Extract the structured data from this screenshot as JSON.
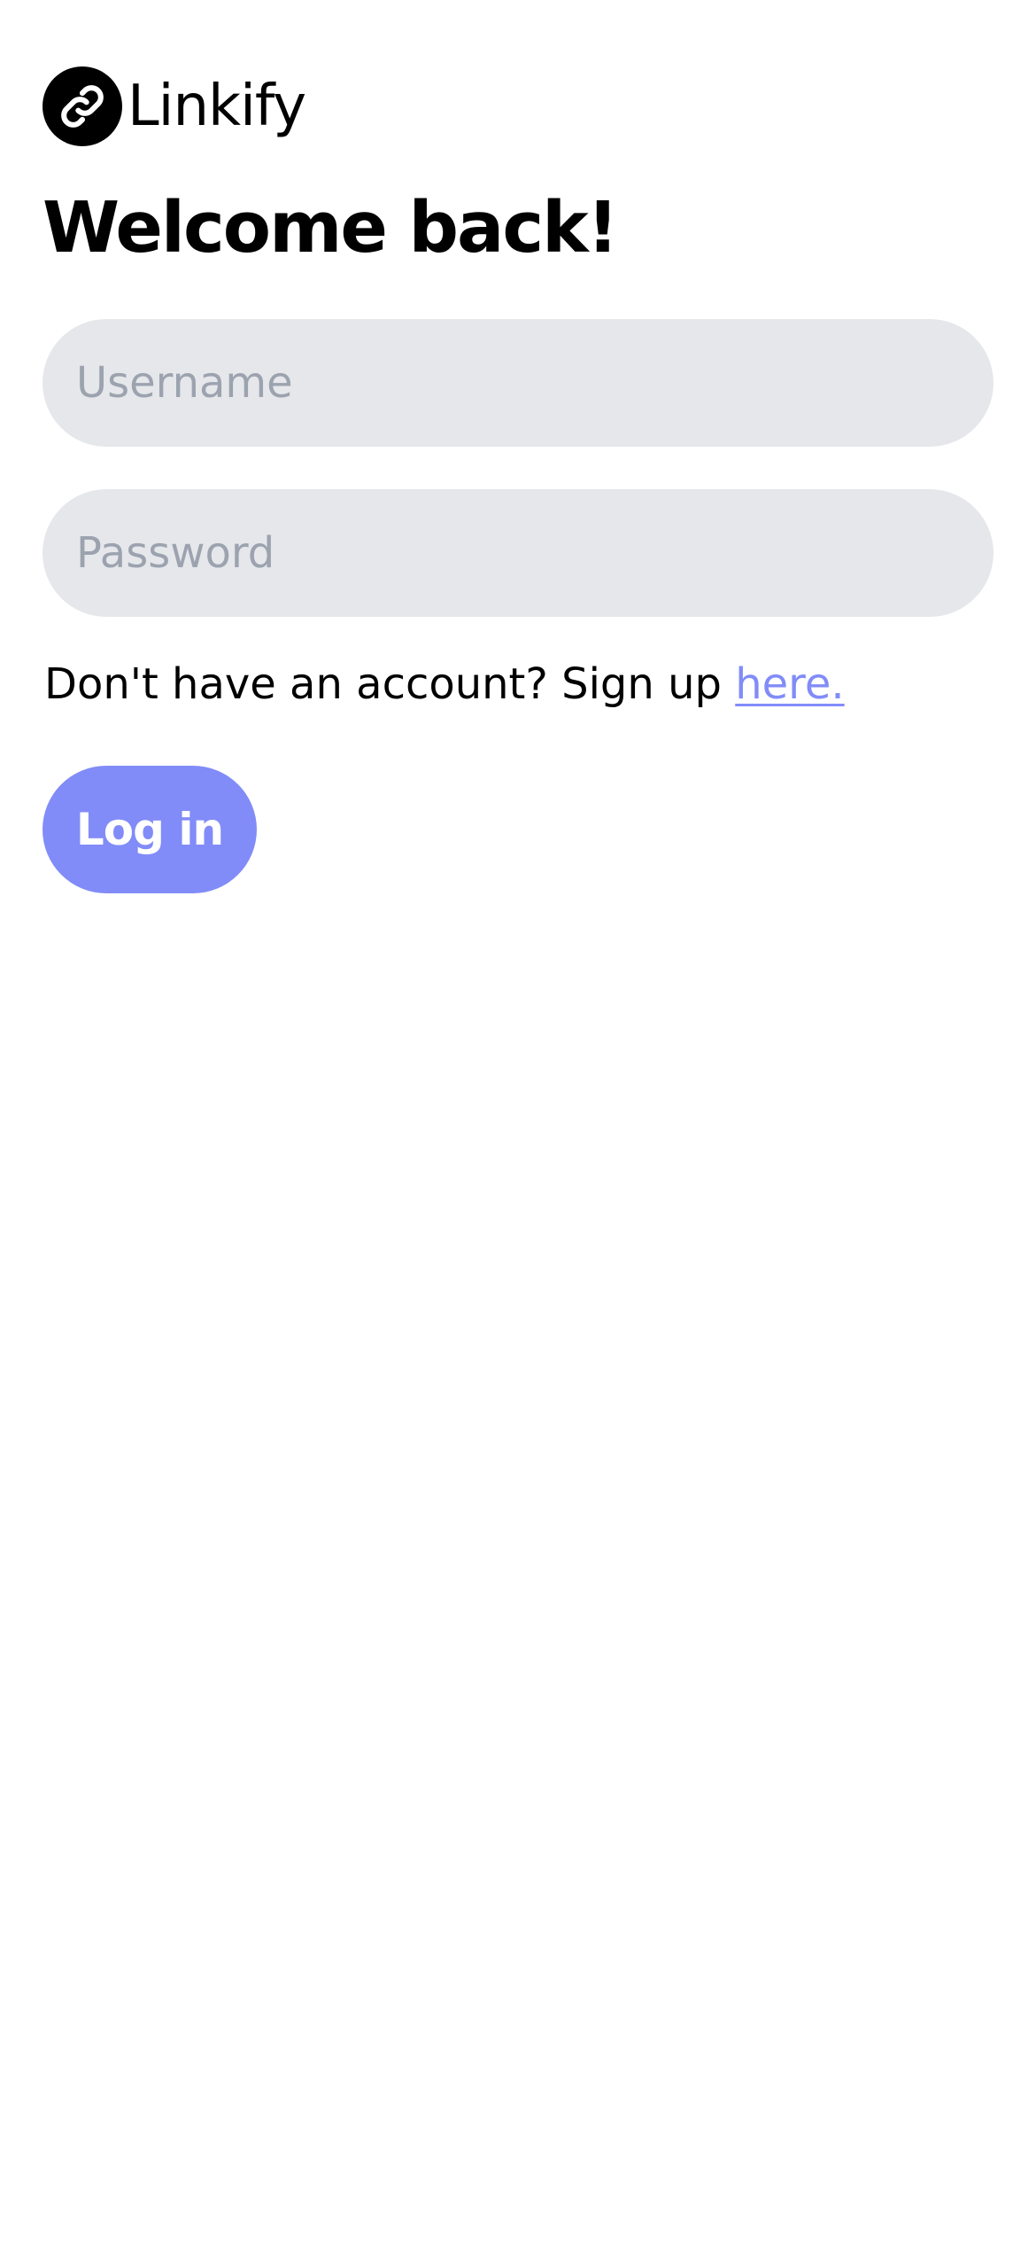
{
  "brand": {
    "name": "Linkify",
    "icon": "link-icon",
    "icon_bg_color": "#000000"
  },
  "heading": "Welcome back!",
  "form": {
    "username": {
      "placeholder": "Username",
      "value": ""
    },
    "password": {
      "placeholder": "Password",
      "value": ""
    },
    "field_bg_color": "#e5e7eb",
    "placeholder_color": "#9ca3af"
  },
  "signup": {
    "prompt": "Don't have an account? Sign up ",
    "link_label": "here.",
    "link_color": "#818cf8"
  },
  "login_button": {
    "label": "Log in",
    "bg_color": "#818cf8",
    "text_color": "#ffffff"
  }
}
